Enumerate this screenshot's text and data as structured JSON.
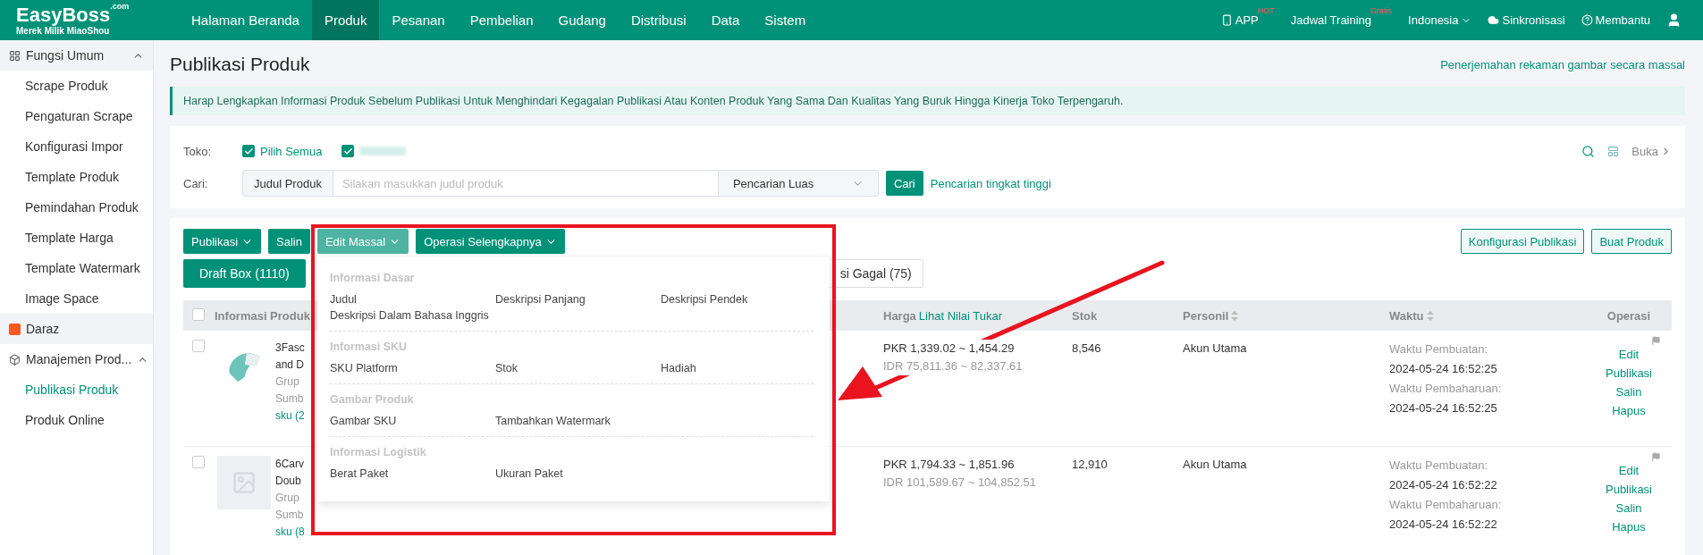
{
  "logo": {
    "name": "EasyBoss",
    "suffix": ".com",
    "tagline": "Merek Milik MiaoShou"
  },
  "nav": {
    "items": [
      {
        "label": "Halaman Beranda",
        "selected": false
      },
      {
        "label": "Produk",
        "selected": true
      },
      {
        "label": "Pesanan",
        "selected": false
      },
      {
        "label": "Pembelian",
        "selected": false
      },
      {
        "label": "Gudang",
        "selected": false
      },
      {
        "label": "Distribusi",
        "selected": false
      },
      {
        "label": "Data",
        "selected": false
      },
      {
        "label": "Sistem",
        "selected": false
      }
    ],
    "right": [
      {
        "kind": "app",
        "label": "APP",
        "badge": "HOT"
      },
      {
        "kind": "training",
        "label": "Jadwal Training",
        "badge": "Gratis"
      },
      {
        "kind": "language",
        "label": "Indonesia"
      },
      {
        "kind": "sync",
        "label": "Sinkronisasi"
      },
      {
        "kind": "help",
        "label": "Membantu"
      }
    ]
  },
  "sidebar": {
    "groups": [
      {
        "label": "Fungsi Umum",
        "kind": "group",
        "expanded": true,
        "highlighted": true,
        "children": [
          {
            "label": "Scrape Produk",
            "selected": false
          },
          {
            "label": "Pengaturan Scrape",
            "selected": false
          },
          {
            "label": "Konfigurasi Impor",
            "selected": false
          },
          {
            "label": "Template Produk",
            "selected": false
          },
          {
            "label": "Pemindahan Produk",
            "selected": false
          },
          {
            "label": "Template Harga",
            "selected": false
          },
          {
            "label": "Template Watermark",
            "selected": false
          },
          {
            "label": "Image Space",
            "selected": false
          }
        ]
      },
      {
        "label": "Daraz",
        "kind": "link",
        "highlighted": true
      },
      {
        "label": "Manajemen Prod...",
        "kind": "group",
        "expanded": true,
        "highlighted": false,
        "children": [
          {
            "label": "Publikasi Produk",
            "selected": true
          },
          {
            "label": "Produk Online",
            "selected": false
          }
        ]
      }
    ]
  },
  "page": {
    "title": "Publikasi Produk",
    "top_link": "Penerjemahan rekaman gambar secara massal",
    "notice": "Harap Lengkapkan Informasi Produk Sebelum Publikasi Untuk Menghindari Kegagalan Publikasi Atau Konten Produk Yang Sama Dan Kualitas Yang Buruk Hingga Kinerja Toko Terpengaruh."
  },
  "filter": {
    "store_label": "Toko:",
    "stores": [
      {
        "label": "Pilih Semua",
        "checked": true
      },
      {
        "checked": true
      }
    ],
    "collapse_label": "Buka",
    "search_label": "Cari:",
    "search_field": "Judul Produk",
    "placeholder": "Silakan masukkan judul produk",
    "search_mode": "Pencarian Luas",
    "search_button": "Cari",
    "advanced_link": "Pencarian tingkat tinggi"
  },
  "toolbar": {
    "buttons": [
      {
        "label": "Publikasi",
        "dropdown": true,
        "open": false
      },
      {
        "label": "Salin",
        "dropdown": false,
        "open": false
      },
      {
        "label": "Edit Massal",
        "dropdown": true,
        "open": true
      },
      {
        "label": "Operasi Selengkapnya",
        "dropdown": true,
        "open": false
      }
    ],
    "right_buttons": [
      "Konfigurasi Publikasi",
      "Buat Produk"
    ]
  },
  "tabs": [
    {
      "label": "Draft Box (1110)",
      "selected": true
    },
    {
      "label": "si Gagal (75)",
      "selected": false
    }
  ],
  "dropdown_menu": {
    "sections": [
      {
        "title": "Informasi Dasar",
        "items": [
          "Judul",
          "Deskripsi Panjang",
          "Deskripsi Pendek",
          "Deskripsi Dalam Bahasa Inggris"
        ]
      },
      {
        "title": "Informasi SKU",
        "items": [
          "SKU Platform",
          "Stok",
          "Hadiah"
        ]
      },
      {
        "title": "Gambar Produk",
        "items": [
          "Gambar SKU",
          "Tambahkan Watermark"
        ]
      },
      {
        "title": "Informasi Logistik",
        "items": [
          "Berat Paket",
          "Ukuran Paket"
        ]
      }
    ]
  },
  "table": {
    "select_all_checked": false,
    "columns": [
      {
        "label": "Informasi Produk",
        "sortable": false
      },
      {
        "label": "Harga",
        "link": "Lihat Nilai Tukar",
        "sortable": false
      },
      {
        "label": "Stok",
        "sortable": false
      },
      {
        "label": "Personil",
        "sortable": true
      },
      {
        "label": "Waktu",
        "sortable": true
      },
      {
        "label": "Operasi",
        "sortable": false
      }
    ],
    "rows": [
      {
        "checked": false,
        "kind": "photo",
        "title_lines": [
          "3Fasc",
          "and D"
        ],
        "group": "Grup",
        "source": "Sumb",
        "sku": "sku (2",
        "price": "PKR 1,339.02 ~ 1,454.29",
        "price_idr": "IDR 75,811.36 ~ 82,337.61",
        "stock": "8,546",
        "personnel": "Akun Utama",
        "created_label": "Waktu Pembuatan:",
        "created": "2024-05-24 16:52:25",
        "updated_label": "Waktu Pembaharuan:",
        "updated": "2024-05-24 16:52:25",
        "actions": [
          "Edit",
          "Publikasi",
          "Salin",
          "Hapus"
        ]
      },
      {
        "checked": false,
        "kind": "placeholder",
        "title_lines": [
          "6Carv",
          "Doub"
        ],
        "group": "Grup",
        "source": "Sumb",
        "sku": "sku (8",
        "price": "PKR 1,794.33 ~ 1,851.96",
        "price_idr": "IDR 101,589.67 ~ 104,852.51",
        "stock": "12,910",
        "personnel": "Akun Utama",
        "created_label": "Waktu Pembuatan:",
        "created": "2024-05-24 16:52:22",
        "updated_label": "Waktu Pembaharuan:",
        "updated": "2024-05-24 16:52:22",
        "actions": [
          "Edit",
          "Publikasi",
          "Salin",
          "Hapus"
        ]
      }
    ]
  }
}
